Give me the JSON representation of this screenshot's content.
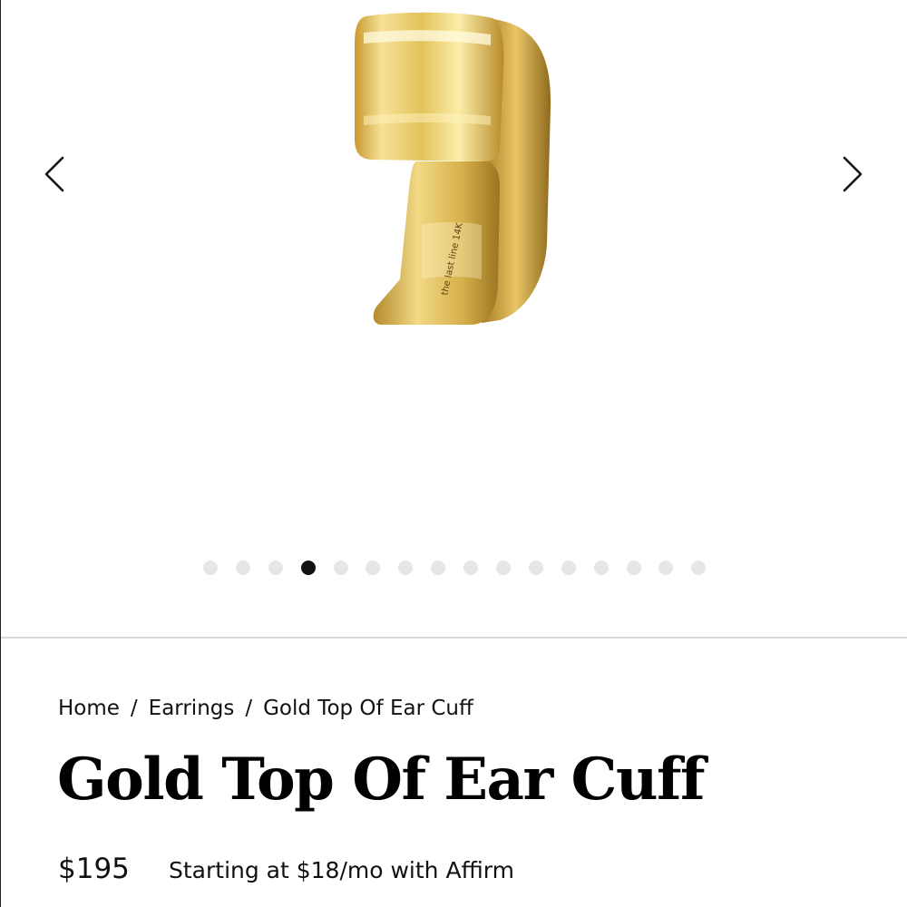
{
  "gallery": {
    "image_alt": "Gold Top Of Ear Cuff",
    "engraving": "the last line 14K",
    "dot_count": 16,
    "active_dot_index": 3,
    "prev_icon": "chevron-left-icon",
    "next_icon": "chevron-right-icon"
  },
  "breadcrumb": {
    "items": [
      "Home",
      "Earrings",
      "Gold Top Of Ear Cuff"
    ],
    "separator": "/"
  },
  "product": {
    "title": "Gold Top Of Ear Cuff",
    "price": "$195",
    "financing": "Starting at $18/mo with Affirm"
  },
  "colors": {
    "gold_light": "#f4dd86",
    "gold_mid": "#d9b24a",
    "gold_dark": "#9c7420",
    "dot_active": "#111111",
    "dot_inactive": "#e6e6e6"
  }
}
